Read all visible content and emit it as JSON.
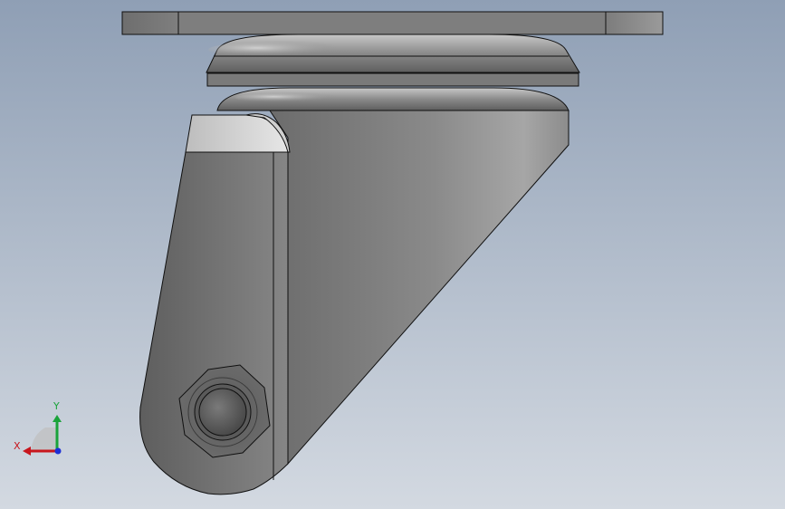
{
  "viewport": {
    "background_top": "#8f9fb5",
    "background_bottom": "#d3d9e1"
  },
  "model": {
    "part_fill": "#8c8c8c",
    "edge_color": "#101010"
  },
  "triad": {
    "x_label": "X",
    "y_label": "Y",
    "x_color": "#c8161d",
    "y_color": "#1aa33a",
    "z_color": "#1c2fd6"
  }
}
